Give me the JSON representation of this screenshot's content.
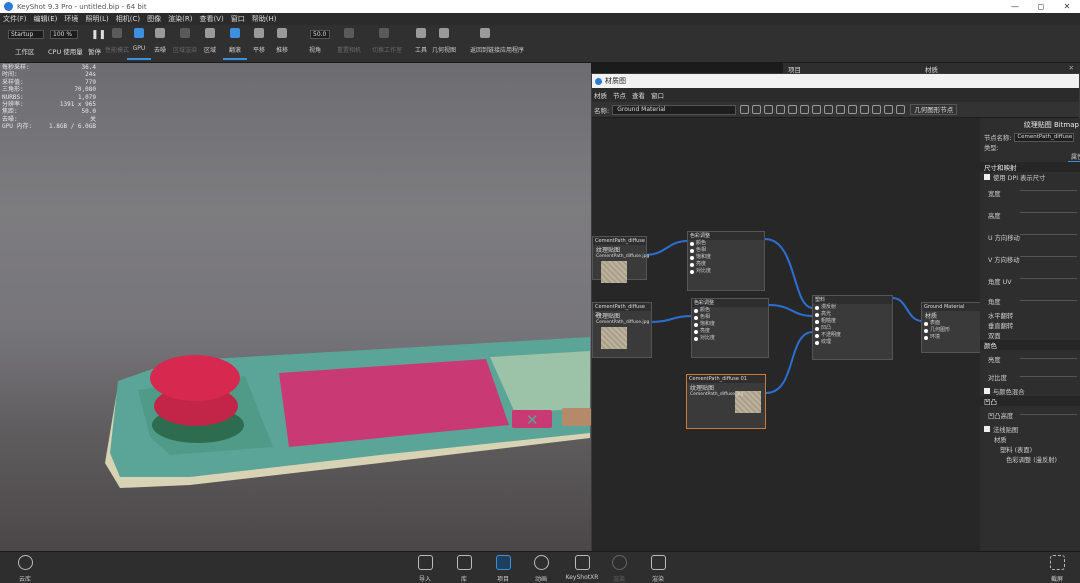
{
  "window": {
    "title": "KeyShot 9.3 Pro - untitled.bip - 64 bit",
    "controls": [
      "—",
      "◻",
      "✕"
    ]
  },
  "menu": [
    "文件(F)",
    "编辑(E)",
    "环境",
    "照明(L)",
    "相机(C)",
    "图像",
    "渲染(R)",
    "查看(V)",
    "窗口",
    "帮助(H)"
  ],
  "toolbar": {
    "workspace": "Startup",
    "zoom": "100 %",
    "fov_value": "50.0",
    "workspace_label": "工作区",
    "cpu_label": "CPU 使用量",
    "pause_label": "暂停",
    "buttons": [
      {
        "label": "性能模式",
        "icon": "performance-icon",
        "dim": true
      },
      {
        "label": "GPU",
        "icon": "gpu-icon",
        "active": true
      },
      {
        "label": "去噪",
        "icon": "denoise-icon"
      },
      {
        "label": "区域渲染",
        "icon": "region-icon",
        "dim": true
      },
      {
        "label": "区域",
        "icon": "region-frame-icon"
      },
      {
        "label": "翻滚",
        "icon": "tumble-icon",
        "active": true
      },
      {
        "label": "平移",
        "icon": "pan-icon"
      },
      {
        "label": "推移",
        "icon": "dolly-icon"
      },
      {
        "label": "视角",
        "icon": "perspective-icon"
      },
      {
        "label": "重置相机",
        "icon": "reset-camera-icon",
        "dim": true
      },
      {
        "label": "切换工作室",
        "icon": "studio-icon",
        "dim": true
      },
      {
        "label": "工具",
        "icon": "tools-icon"
      },
      {
        "label": "几何视图",
        "icon": "geometry-view-icon"
      },
      {
        "label": "返回到链接应用程序",
        "icon": "link-app-icon"
      }
    ]
  },
  "stats": [
    {
      "label": "每秒采样:",
      "value": "36.4"
    },
    {
      "label": "时间:",
      "value": "24s"
    },
    {
      "label": "采样值:",
      "value": "779"
    },
    {
      "label": "三角形:",
      "value": "70,080"
    },
    {
      "label": "NURBS:",
      "value": "1,079"
    },
    {
      "label": "分辨率:",
      "value": "1391 x 965"
    },
    {
      "label": "焦距:",
      "value": "50.0"
    },
    {
      "label": "去噪:",
      "value": "关"
    },
    {
      "label": "GPU 内存:",
      "value": "1.8GB / 6.0GB"
    }
  ],
  "right_panel": {
    "project_label": "项目",
    "material_label": "材质",
    "close": "✕"
  },
  "material_window": {
    "title": "材质图",
    "menu": [
      "材质",
      "节点",
      "查看",
      "窗口"
    ],
    "name_label": "名称:",
    "name_value": "Ground Material",
    "geo_node_button": "几何图形节点",
    "nodes": {
      "tex1": {
        "header": "CementPath_diffuse",
        "sub": "纹理贴图",
        "file": "CementPath_diffuse.jpg"
      },
      "tex2": {
        "header": "CementPath_diffuse 2b",
        "sub": "纹理贴图",
        "file": "CementPath_diffuse.jpg"
      },
      "cc1": {
        "header": "色彩调整",
        "ports": [
          "颜色",
          "色相",
          "饱和度",
          "亮度",
          "对比度"
        ]
      },
      "cc2": {
        "header": "色彩调整",
        "ports": [
          "颜色",
          "色相",
          "饱和度",
          "亮度",
          "对比度"
        ]
      },
      "tex3": {
        "header": "CementPath_diffuse 01",
        "sub": "纹理贴图",
        "file": "CementPath_diffuse.jpg"
      },
      "plastic": {
        "header": "塑料",
        "ports": [
          "漫反射",
          "高光",
          "粗糙度",
          "凹凸",
          "不透明度",
          "纹理"
        ]
      },
      "out": {
        "header": "Ground Material",
        "sub": "材质",
        "ports": [
          "表面",
          "几何图形",
          "环境"
        ]
      }
    },
    "props": {
      "header": "纹理贴图 Bitmap",
      "node_name_label": "节点名称:",
      "node_name_value": "CementPath_diffuse",
      "type_label": "类型:",
      "tab_label": "属性",
      "sections": [
        "尺寸和映射",
        "颜色",
        "凹凸"
      ],
      "rows": {
        "dpi": "使用 DPI 表示尺寸",
        "width": "宽度",
        "height": "高度",
        "u_shift": "U 方向移动",
        "v_shift": "V 方向移动",
        "uv_angle": "角度 UV",
        "angle": "角度",
        "flip_h": "水平翻转",
        "flip_v": "垂直翻转",
        "two_sided": "双面",
        "brightness": "亮度",
        "contrast": "对比度",
        "color_blend": "与颜色混合",
        "bump_height": "凹凸高度",
        "normal_map": "法线贴图",
        "tree_material": "材质",
        "tree_plastic": "塑料 (表面)",
        "tree_cc": "色彩调整 (漫反射)"
      }
    }
  },
  "bottombar": {
    "cloud_library": "云库",
    "screenshot": "截屏",
    "buttons": [
      {
        "label": "导入",
        "icon": "import-icon"
      },
      {
        "label": "库",
        "icon": "library-icon"
      },
      {
        "label": "项目",
        "icon": "project-icon",
        "active": true
      },
      {
        "label": "动画",
        "icon": "animation-icon"
      },
      {
        "label": "KeyShotXR",
        "icon": "keyshotxr-icon"
      },
      {
        "label": "渲染",
        "icon": "render-icon",
        "dim": true
      },
      {
        "label": "渲染",
        "icon": "render-output-icon"
      }
    ]
  },
  "colors": {
    "accent": "#3d8fe0",
    "node_border_selected": "#c97c3a",
    "board_teal": "#5aa597",
    "pad_pink": "#c93a74",
    "button_red": "#d7284f"
  }
}
